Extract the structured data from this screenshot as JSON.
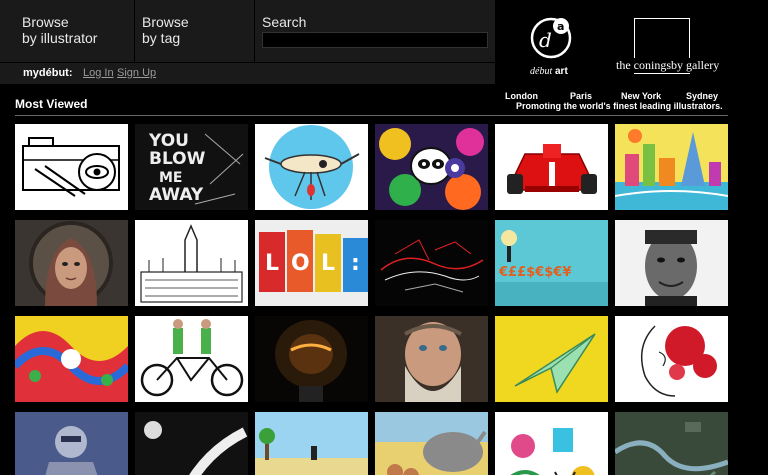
{
  "nav": {
    "browse_illustrator": {
      "line1": "Browse",
      "line2": "by illustrator"
    },
    "browse_tag": {
      "line1": "Browse",
      "line2": "by tag"
    },
    "search_label": "Search",
    "search_value": ""
  },
  "account": {
    "brand": "mydébut:",
    "login": "Log In",
    "signup": "Sign Up"
  },
  "logos": {
    "debut_art": {
      "word1": "début",
      "word2": "art"
    },
    "gallery": "the coningsby gallery"
  },
  "cities": [
    "London",
    "Paris",
    "New York",
    "Sydney"
  ],
  "tagline": "Promoting the world's finest leading illustrators.",
  "section_title": "Most Viewed",
  "thumbnails": [
    {
      "row": 1,
      "col": 1,
      "subject": "camera-eye line drawing"
    },
    {
      "row": 1,
      "col": 2,
      "subject": "YOU BLOW ME AWAY typography"
    },
    {
      "row": 1,
      "col": 3,
      "subject": "mosquito on blue circle"
    },
    {
      "row": 1,
      "col": 4,
      "subject": "colorful panda characters"
    },
    {
      "row": 1,
      "col": 5,
      "subject": "red racing car"
    },
    {
      "row": 1,
      "col": 6,
      "subject": "colorful city skyline"
    },
    {
      "row": 2,
      "col": 1,
      "subject": "portrait of woman in hood"
    },
    {
      "row": 2,
      "col": 2,
      "subject": "parliament building drawing"
    },
    {
      "row": 2,
      "col": 3,
      "subject": "LOL blocks"
    },
    {
      "row": 2,
      "col": 4,
      "subject": "neon line swimmer"
    },
    {
      "row": 2,
      "col": 5,
      "subject": "currency symbols with figure"
    },
    {
      "row": 2,
      "col": 6,
      "subject": "black and white portrait"
    },
    {
      "row": 3,
      "col": 1,
      "subject": "decorative pattern"
    },
    {
      "row": 3,
      "col": 2,
      "subject": "tandem bicycle riders"
    },
    {
      "row": 3,
      "col": 3,
      "subject": "glowing light bulb"
    },
    {
      "row": 3,
      "col": 4,
      "subject": "bearded man painting"
    },
    {
      "row": 3,
      "col": 5,
      "subject": "paper plane on yellow"
    },
    {
      "row": 3,
      "col": 6,
      "subject": "woman with red splatter"
    },
    {
      "row": 4,
      "col": 1,
      "subject": "robot warrior"
    },
    {
      "row": 4,
      "col": 2,
      "subject": "moon and leg"
    },
    {
      "row": 4,
      "col": 3,
      "subject": "pixel beach scene"
    },
    {
      "row": 4,
      "col": 4,
      "subject": "rhino with tourists"
    },
    {
      "row": 4,
      "col": 5,
      "subject": "colorful doodles"
    },
    {
      "row": 4,
      "col": 6,
      "subject": "satellite river map"
    }
  ]
}
